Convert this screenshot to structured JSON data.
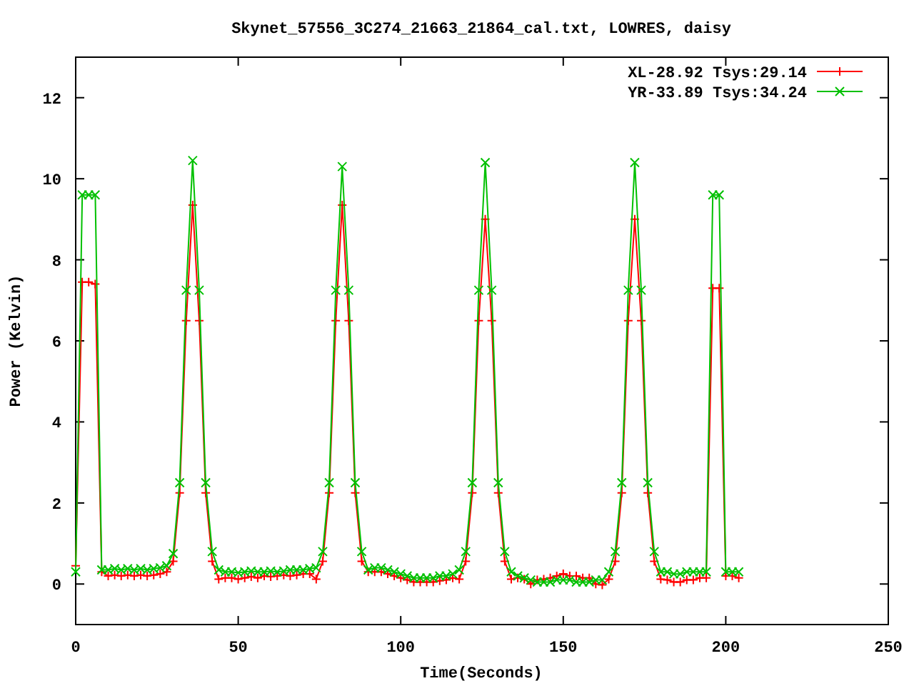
{
  "chart_data": {
    "type": "line",
    "title": "Skynet_57556_3C274_21663_21864_cal.txt, LOWRES, daisy",
    "xlabel": "Time(Seconds)",
    "ylabel": "Power (Kelvin)",
    "xlim": [
      0,
      250
    ],
    "ylim": [
      -1,
      13
    ],
    "xticks": [
      0,
      50,
      100,
      150,
      200,
      250
    ],
    "yticks": [
      0,
      2,
      4,
      6,
      8,
      10,
      12
    ],
    "legend": true,
    "x": [
      0,
      2,
      4,
      6,
      8,
      10,
      12,
      14,
      16,
      18,
      20,
      22,
      24,
      26,
      28,
      30,
      32,
      34,
      36,
      38,
      40,
      42,
      44,
      46,
      48,
      50,
      52,
      54,
      56,
      58,
      60,
      62,
      64,
      66,
      68,
      70,
      72,
      74,
      76,
      78,
      80,
      82,
      84,
      86,
      88,
      90,
      92,
      94,
      96,
      98,
      100,
      102,
      104,
      106,
      108,
      110,
      112,
      114,
      116,
      118,
      120,
      122,
      124,
      126,
      128,
      130,
      132,
      134,
      136,
      138,
      140,
      142,
      144,
      146,
      148,
      150,
      152,
      154,
      156,
      158,
      160,
      162,
      164,
      166,
      168,
      170,
      172,
      174,
      176,
      178,
      180,
      182,
      184,
      186,
      188,
      190,
      192,
      194,
      196,
      198,
      200,
      202,
      204
    ],
    "series": [
      {
        "name": "XL-28.92 Tsys:29.14",
        "color": "#ff0000",
        "marker": "plus",
        "values": [
          0.45,
          7.45,
          7.45,
          7.4,
          0.3,
          0.2,
          0.22,
          0.2,
          0.22,
          0.2,
          0.22,
          0.2,
          0.22,
          0.25,
          0.3,
          0.56,
          2.25,
          6.5,
          9.35,
          6.5,
          2.25,
          0.56,
          0.12,
          0.15,
          0.15,
          0.12,
          0.15,
          0.18,
          0.15,
          0.2,
          0.18,
          0.2,
          0.22,
          0.2,
          0.22,
          0.25,
          0.25,
          0.12,
          0.56,
          2.25,
          6.5,
          9.35,
          6.5,
          2.25,
          0.56,
          0.3,
          0.3,
          0.3,
          0.25,
          0.2,
          0.15,
          0.1,
          0.05,
          0.05,
          0.05,
          0.05,
          0.08,
          0.1,
          0.15,
          0.12,
          0.56,
          2.25,
          6.5,
          9.0,
          6.5,
          2.25,
          0.56,
          0.12,
          0.15,
          0.12,
          0.0,
          0.1,
          0.12,
          0.15,
          0.2,
          0.25,
          0.2,
          0.2,
          0.15,
          0.15,
          0.0,
          -0.02,
          0.12,
          0.56,
          2.25,
          6.5,
          9.0,
          6.5,
          2.25,
          0.56,
          0.12,
          0.1,
          0.05,
          0.05,
          0.1,
          0.1,
          0.15,
          0.15,
          7.3,
          7.3,
          0.2,
          0.2,
          0.15
        ]
      },
      {
        "name": "YR-33.89 Tsys:34.24",
        "color": "#00c000",
        "marker": "cross",
        "values": [
          0.3,
          9.6,
          9.6,
          9.6,
          0.35,
          0.35,
          0.38,
          0.35,
          0.38,
          0.35,
          0.38,
          0.35,
          0.38,
          0.4,
          0.45,
          0.75,
          2.5,
          7.25,
          10.45,
          7.25,
          2.5,
          0.8,
          0.35,
          0.3,
          0.3,
          0.28,
          0.3,
          0.32,
          0.3,
          0.3,
          0.32,
          0.3,
          0.32,
          0.35,
          0.35,
          0.35,
          0.38,
          0.4,
          0.8,
          2.5,
          7.25,
          10.3,
          7.25,
          2.5,
          0.8,
          0.35,
          0.4,
          0.4,
          0.35,
          0.3,
          0.25,
          0.2,
          0.15,
          0.15,
          0.15,
          0.15,
          0.2,
          0.2,
          0.25,
          0.35,
          0.8,
          2.5,
          7.25,
          10.4,
          7.25,
          2.5,
          0.8,
          0.3,
          0.2,
          0.15,
          0.1,
          0.05,
          0.05,
          0.05,
          0.1,
          0.1,
          0.1,
          0.05,
          0.05,
          0.05,
          0.1,
          0.1,
          0.3,
          0.8,
          2.5,
          7.25,
          10.4,
          7.25,
          2.5,
          0.8,
          0.3,
          0.3,
          0.25,
          0.25,
          0.3,
          0.3,
          0.3,
          0.3,
          9.6,
          9.6,
          0.3,
          0.3,
          0.3
        ]
      }
    ]
  }
}
